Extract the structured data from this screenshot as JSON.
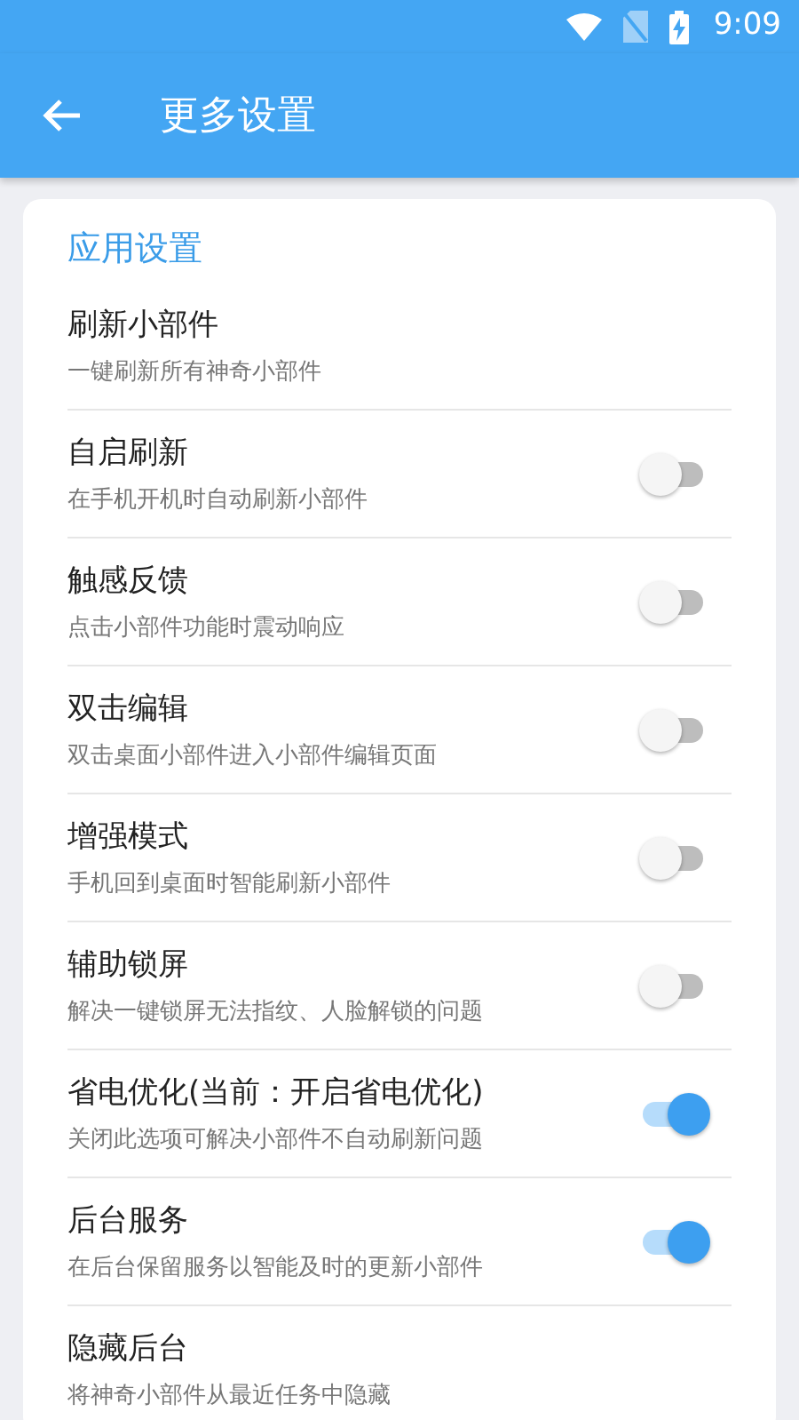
{
  "status_bar": {
    "time": "9:09"
  },
  "app_bar": {
    "title": "更多设置"
  },
  "section": {
    "title": "应用设置",
    "items": [
      {
        "kind": "plain",
        "title": "刷新小部件",
        "subtitle": "一键刷新所有神奇小部件"
      },
      {
        "kind": "switch",
        "title": "自启刷新",
        "subtitle": "在手机开机时自动刷新小部件",
        "on": false
      },
      {
        "kind": "switch",
        "title": "触感反馈",
        "subtitle": "点击小部件功能时震动响应",
        "on": false
      },
      {
        "kind": "switch",
        "title": "双击编辑",
        "subtitle": "双击桌面小部件进入小部件编辑页面",
        "on": false
      },
      {
        "kind": "switch",
        "title": "增强模式",
        "subtitle": "手机回到桌面时智能刷新小部件",
        "on": false
      },
      {
        "kind": "switch",
        "title": "辅助锁屏",
        "subtitle": "解决一键锁屏无法指纹、人脸解锁的问题",
        "on": false
      },
      {
        "kind": "switch",
        "title": "省电优化(当前：开启省电优化)",
        "subtitle": "关闭此选项可解决小部件不自动刷新问题",
        "on": true
      },
      {
        "kind": "switch",
        "title": "后台服务",
        "subtitle": "在后台保留服务以智能及时的更新小部件",
        "on": true
      },
      {
        "kind": "plain",
        "title": "隐藏后台",
        "subtitle": "将神奇小部件从最近任务中隐藏"
      }
    ]
  }
}
